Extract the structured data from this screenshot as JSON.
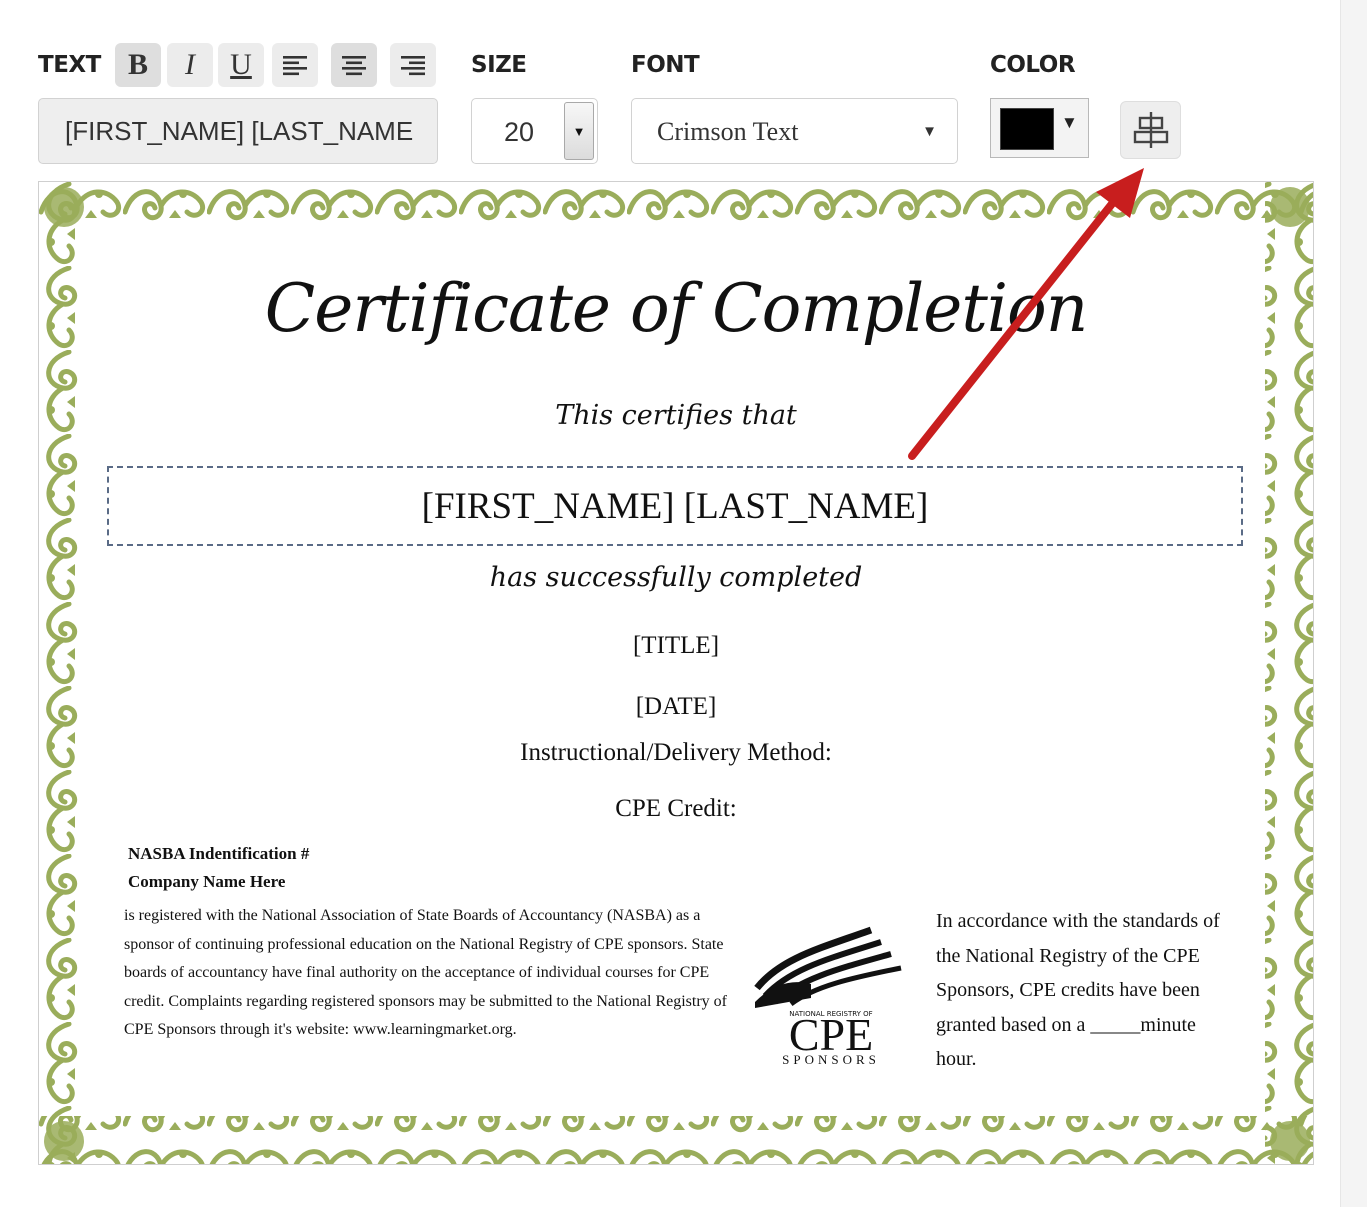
{
  "toolbar": {
    "text_label": "TEXT",
    "size_label": "SIZE",
    "font_label": "FONT",
    "color_label": "COLOR",
    "bold_glyph": "B",
    "italic_glyph": "I",
    "underline_glyph": "U",
    "text_value": "[FIRST_NAME] [LAST_NAME",
    "size_value": "20",
    "font_value": "Crimson Text",
    "color_value": "#000000",
    "icons": [
      "bold-icon",
      "italic-icon",
      "underline-icon",
      "align-left-icon",
      "align-center-icon",
      "align-right-icon",
      "center-horizontally-icon"
    ]
  },
  "certificate": {
    "heading": "Certificate of Completion",
    "certifies": "This certifies that",
    "name_placeholder": "[FIRST_NAME] [LAST_NAME]",
    "completed": "has successfully completed",
    "title_placeholder": "[TITLE]",
    "date_placeholder": "[DATE]",
    "method_label": "Instructional/Delivery Method:",
    "cpe_label": "CPE Credit:",
    "nasba_id": "NASBA Indentification #",
    "company": "Company Name Here",
    "nasba_text": "is registered with the National Association of State Boards of Accountancy (NASBA) as a sponsor of continuing professional education on the National Registry of CPE sponsors. State boards of accountancy have final authority on the acceptance of individual courses for CPE credit. Complaints regarding registered sponsors may be submitted to the National Registry of CPE Sponsors through it's website: www.learningmarket.org.",
    "accordance_text": "In accordance with the standards of the National Registry of the CPE Sponsors, CPE credits have been granted based on a _____minute hour.",
    "logo_ring_text": "NATIONAL REGISTRY OF",
    "logo_main": "CPE",
    "logo_sub": "SPONSORS",
    "border_color": "#9aad5b"
  }
}
